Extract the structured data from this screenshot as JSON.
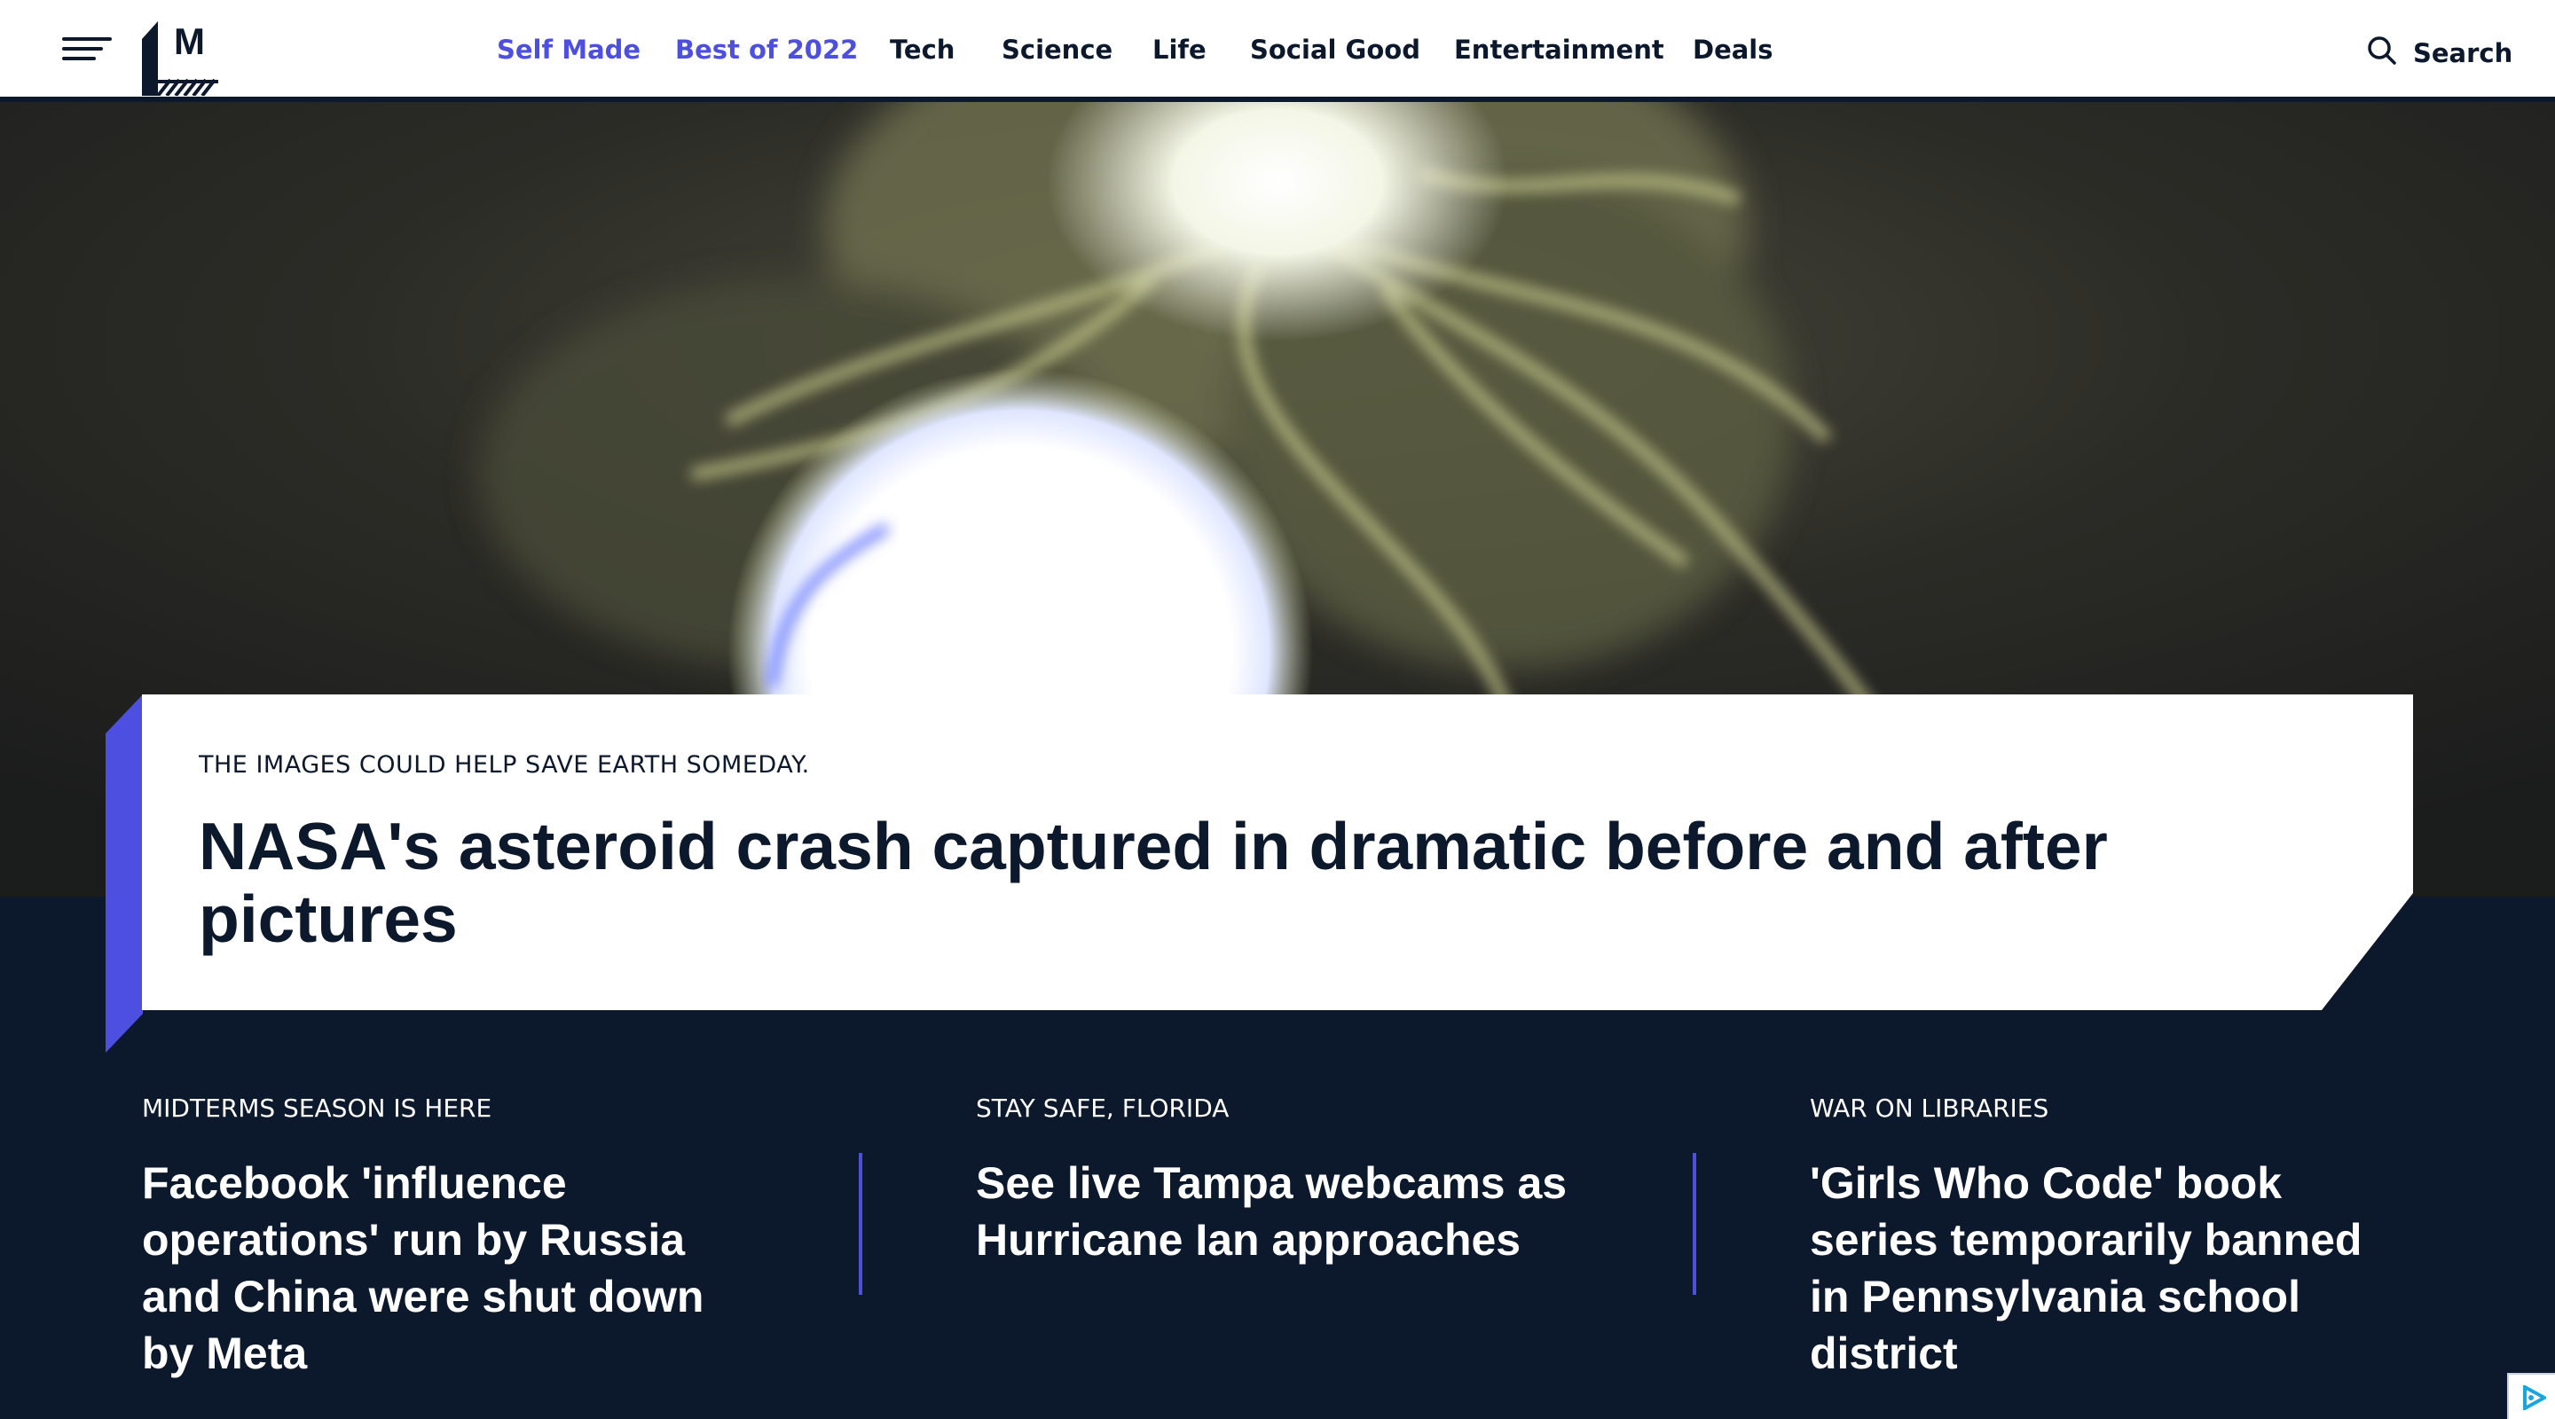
{
  "header": {
    "logo_letter": "M",
    "nav": [
      {
        "label": "Self Made",
        "accent": true
      },
      {
        "label": "Best of 2022",
        "accent": true
      },
      {
        "label": "Tech",
        "accent": false
      },
      {
        "label": "Science",
        "accent": false
      },
      {
        "label": "Life",
        "accent": false
      },
      {
        "label": "Social Good",
        "accent": false
      },
      {
        "label": "Entertainment",
        "accent": false
      },
      {
        "label": "Deals",
        "accent": false
      }
    ],
    "search_label": "Search"
  },
  "hero": {
    "kicker": "THE IMAGES COULD HELP SAVE EARTH SOMEDAY.",
    "headline": "NASA's asteroid crash captured in dramatic before and after pictures"
  },
  "stories": [
    {
      "kicker": "MIDTERMS SEASON IS HERE",
      "title": "Facebook 'influence operations' run by Russia and China were shut down by Meta"
    },
    {
      "kicker": "STAY SAFE, FLORIDA",
      "title": "See live Tampa webcams as Hurricane Ian approaches"
    },
    {
      "kicker": "WAR ON LIBRARIES",
      "title": "'Girls Who Code' book series temporarily banned in Pennsylvania school district"
    }
  ],
  "colors": {
    "navy": "#0c182b",
    "accent": "#4d4fe0",
    "white": "#ffffff"
  },
  "icons": [
    "hamburger-menu-icon",
    "mashable-logo",
    "search-icon",
    "ad-choices-icon"
  ]
}
